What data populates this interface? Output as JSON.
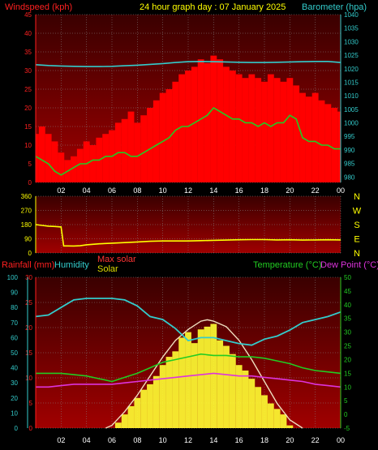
{
  "colors": {
    "background": "#000000",
    "plot_bg_top": "#4a0000",
    "plot_bg_bottom": "#a80000",
    "grid": "#8a8a8a",
    "wind_label": "#ff2020",
    "gust": "#ff0000",
    "avg_wind": "#22cc22",
    "barometer": "#33cccc",
    "direction": "#ffff00",
    "direction_labels": "#ffff00",
    "rain_axis": "#ff2020",
    "humidity": "#33cccc",
    "max_solar": "#ff3333",
    "solar": "#ffff33",
    "temperature": "#22cc22",
    "dew_point": "#dd33dd",
    "title": "#ffff00",
    "tick": "#ffffff"
  },
  "header": {
    "title": "24 hour graph day : 07 January 2025",
    "left_label": "Windspeed (kph)",
    "right_label": "Barometer (hpa)"
  },
  "bottom_header": {
    "rainfall": "Rainfall (mm)",
    "humidity": "Humidity",
    "max_solar": "Max solar",
    "solar": "Solar",
    "temperature": "Temperature (°C)",
    "dew_point": "Dew Point (°C)"
  },
  "x_ticks": [
    "02",
    "04",
    "06",
    "08",
    "10",
    "12",
    "14",
    "16",
    "18",
    "20",
    "22",
    "00"
  ],
  "chart_data": [
    {
      "type": "line",
      "name": "wind_barometer",
      "x_unit": "hours",
      "xlim": [
        0,
        24
      ],
      "y_left": {
        "label": "Windspeed (kph)",
        "ylim": [
          0,
          45
        ],
        "ticks": [
          0,
          5,
          10,
          15,
          20,
          25,
          30,
          35,
          40,
          45
        ]
      },
      "y_right": {
        "label": "Barometer (hpa)",
        "ylim": [
          978,
          1040
        ],
        "ticks": [
          980,
          985,
          990,
          995,
          1000,
          1005,
          1010,
          1015,
          1020,
          1025,
          1030,
          1035,
          1040
        ]
      },
      "series": [
        {
          "name": "gust",
          "axis": "left",
          "style": "bars",
          "x": [
            0,
            0.5,
            1,
            1.5,
            2,
            2.5,
            3,
            3.5,
            4,
            4.5,
            5,
            5.5,
            6,
            6.5,
            7,
            7.5,
            8,
            8.5,
            9,
            9.5,
            10,
            10.5,
            11,
            11.5,
            12,
            12.5,
            13,
            13.5,
            14,
            14.5,
            15,
            15.5,
            16,
            16.5,
            17,
            17.5,
            18,
            18.5,
            19,
            19.5,
            20,
            20.5,
            21,
            21.5,
            22,
            22.5,
            23,
            23.5,
            24
          ],
          "values": [
            13,
            15,
            13,
            11,
            8,
            6,
            7,
            9,
            11,
            10,
            12,
            13,
            14,
            16,
            17,
            19,
            16,
            18,
            20,
            22,
            24,
            25,
            27,
            29,
            30,
            31,
            33,
            32,
            34,
            33,
            31,
            30,
            29,
            28,
            29,
            28,
            27,
            29,
            28,
            27,
            28,
            26,
            24,
            23,
            24,
            22,
            21,
            20,
            19
          ]
        },
        {
          "name": "average wind",
          "axis": "left",
          "style": "line",
          "x": [
            0,
            0.5,
            1,
            1.5,
            2,
            2.5,
            3,
            3.5,
            4,
            4.5,
            5,
            5.5,
            6,
            6.5,
            7,
            7.5,
            8,
            8.5,
            9,
            9.5,
            10,
            10.5,
            11,
            11.5,
            12,
            12.5,
            13,
            13.5,
            14,
            14.5,
            15,
            15.5,
            16,
            16.5,
            17,
            17.5,
            18,
            18.5,
            19,
            19.5,
            20,
            20.5,
            21,
            21.5,
            22,
            22.5,
            23,
            23.5,
            24
          ],
          "values": [
            7,
            6,
            5,
            3,
            2,
            3,
            4,
            5,
            5,
            6,
            6,
            7,
            7,
            8,
            8,
            7,
            7,
            8,
            9,
            10,
            11,
            12,
            14,
            15,
            15,
            16,
            17,
            18,
            20,
            19,
            18,
            17,
            17,
            16,
            16,
            15,
            16,
            15,
            16,
            16,
            18,
            17,
            12,
            11,
            11,
            10,
            10,
            9,
            9
          ]
        },
        {
          "name": "barometer",
          "axis": "right",
          "style": "line",
          "x": [
            0,
            1,
            2,
            3,
            4,
            5,
            6,
            7,
            8,
            9,
            10,
            11,
            12,
            13,
            14,
            15,
            16,
            17,
            18,
            19,
            20,
            21,
            22,
            23,
            24
          ],
          "values": [
            1021.5,
            1021.2,
            1021.0,
            1020.9,
            1020.8,
            1020.8,
            1020.9,
            1021.1,
            1021.3,
            1021.6,
            1021.9,
            1022.3,
            1022.6,
            1022.7,
            1022.6,
            1022.5,
            1022.4,
            1022.3,
            1022.3,
            1022.4,
            1022.5,
            1022.6,
            1022.7,
            1022.7,
            1022.3
          ]
        }
      ]
    },
    {
      "type": "line",
      "name": "wind_direction",
      "x_unit": "hours",
      "xlim": [
        0,
        24
      ],
      "ylim": [
        0,
        360
      ],
      "y_ticks": [
        0,
        90,
        180,
        270,
        360
      ],
      "compass_labels": [
        "N",
        "W",
        "S",
        "E",
        "N"
      ],
      "series": [
        {
          "name": "direction",
          "x": [
            0,
            0.5,
            1,
            1.5,
            2,
            2.2,
            2.5,
            3,
            3.5,
            4,
            5,
            6,
            7,
            8,
            9,
            10,
            11,
            12,
            13,
            14,
            15,
            16,
            17,
            18,
            19,
            20,
            21,
            22,
            23,
            24
          ],
          "values": [
            180,
            175,
            170,
            168,
            165,
            45,
            45,
            44,
            46,
            52,
            58,
            62,
            66,
            70,
            74,
            76,
            76,
            76,
            78,
            80,
            82,
            84,
            85,
            85,
            83,
            84,
            82,
            83,
            84,
            83
          ]
        }
      ]
    },
    {
      "type": "line",
      "name": "rain_humidity_solar_temperature",
      "x_unit": "hours",
      "xlim": [
        0,
        24
      ],
      "y_left_rain": {
        "label": "Rainfall (mm)",
        "ylim": [
          0,
          30
        ],
        "ticks": [
          0,
          5,
          10,
          15,
          20,
          25,
          30
        ]
      },
      "y_left_humidity": {
        "label": "Humidity",
        "ylim": [
          0,
          100
        ],
        "ticks": [
          0,
          10,
          20,
          30,
          40,
          50,
          60,
          70,
          80,
          90,
          100
        ]
      },
      "y_right": {
        "label": "Temperature (°C)",
        "ylim": [
          -5,
          50
        ],
        "ticks": [
          -5,
          0,
          5,
          10,
          15,
          20,
          25,
          30,
          35,
          40,
          45,
          50
        ]
      },
      "series": [
        {
          "name": "Humidity",
          "axis": "humidity",
          "x": [
            0,
            1,
            2,
            3,
            4,
            5,
            6,
            7,
            8,
            9,
            10,
            11,
            12,
            13,
            14,
            15,
            16,
            17,
            18,
            19,
            20,
            21,
            22,
            23,
            24
          ],
          "values": [
            74,
            75,
            80,
            85,
            86,
            86,
            86,
            85,
            81,
            74,
            72,
            66,
            58,
            60,
            60,
            58,
            56,
            55,
            59,
            61,
            65,
            70,
            72,
            74,
            77
          ]
        },
        {
          "name": "Max solar",
          "axis": "right",
          "x": [
            5.5,
            6,
            7,
            8,
            9,
            10,
            11,
            12,
            13,
            13.5,
            14,
            15,
            16,
            17,
            18,
            19,
            20,
            21
          ],
          "values": [
            -5,
            -4,
            1,
            7,
            14,
            21,
            27,
            31,
            34,
            34.5,
            34,
            32,
            27,
            20,
            12,
            4,
            -2,
            -5
          ]
        },
        {
          "name": "Solar",
          "axis": "right",
          "style": "bars",
          "x": [
            6,
            6.5,
            7,
            7.5,
            8,
            8.5,
            9,
            9.5,
            10,
            10.5,
            11,
            11.5,
            12,
            12.5,
            13,
            13.5,
            14,
            14.5,
            15,
            15.5,
            16,
            16.5,
            17,
            17.5,
            18,
            18.5,
            19,
            19.5,
            20
          ],
          "values": [
            -5,
            -3,
            0,
            3,
            6,
            9,
            11,
            14,
            18,
            21,
            23,
            28,
            30,
            26,
            31,
            32,
            33,
            27,
            25,
            22,
            18,
            16,
            13,
            10,
            7,
            4,
            2,
            0,
            -4
          ]
        },
        {
          "name": "Temperature",
          "axis": "right",
          "x": [
            0,
            1,
            2,
            3,
            4,
            5,
            6,
            7,
            8,
            9,
            10,
            11,
            12,
            13,
            14,
            15,
            16,
            17,
            18,
            19,
            20,
            21,
            22,
            23,
            24
          ],
          "values": [
            15,
            15,
            15,
            14.5,
            14,
            13,
            12,
            13.5,
            15,
            17,
            19,
            20,
            21,
            22,
            21.5,
            21.5,
            21,
            21,
            20.5,
            19.5,
            18.5,
            17,
            16,
            15.5,
            15
          ]
        },
        {
          "name": "Dew Point",
          "axis": "right",
          "x": [
            0,
            1,
            2,
            3,
            4,
            5,
            6,
            7,
            8,
            9,
            10,
            11,
            12,
            13,
            14,
            15,
            16,
            17,
            18,
            19,
            20,
            21,
            22,
            23,
            24
          ],
          "values": [
            10,
            10,
            10.5,
            11,
            11,
            11,
            11,
            11.5,
            12,
            12.5,
            13,
            13.5,
            14,
            14.5,
            15,
            14.5,
            14,
            14,
            13.5,
            13,
            12.5,
            12,
            11,
            10.5,
            10
          ]
        }
      ]
    }
  ]
}
